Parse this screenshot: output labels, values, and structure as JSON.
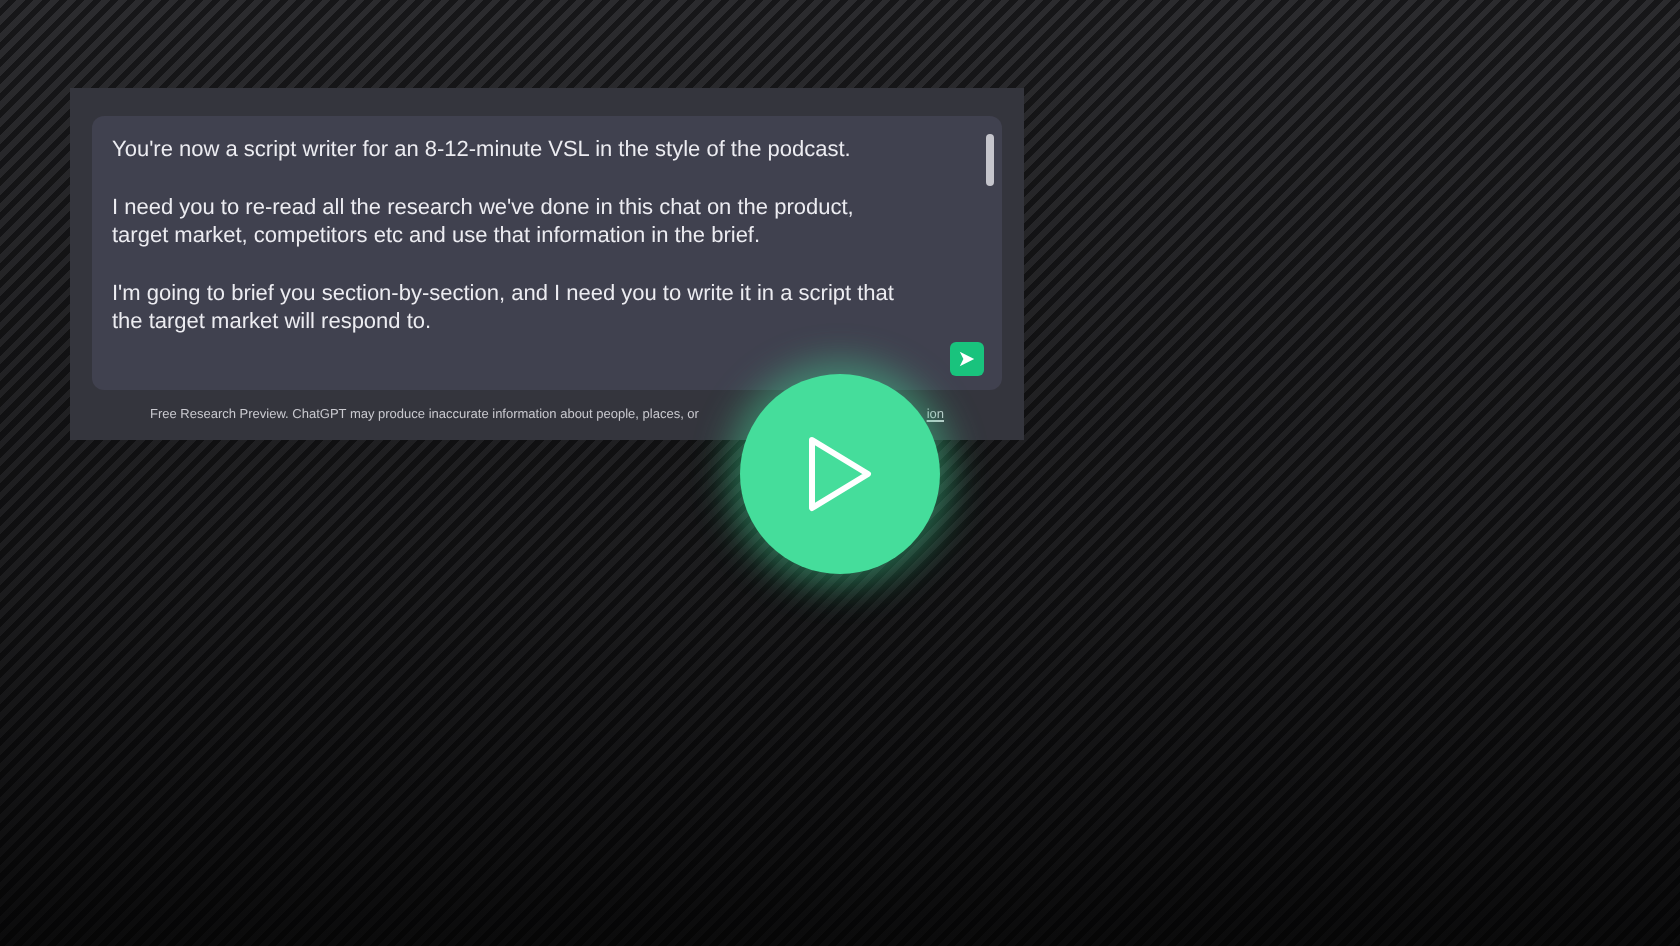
{
  "prompt": {
    "paragraphs": [
      "You're now a script writer for an 8-12-minute VSL in the style of the podcast.",
      "I need you to re-read all the research we've done in this chat on the product, target market, competitors etc and use that information in the brief.",
      "I'm going to brief you section-by-section, and I need you to write it in a script that the target market will respond to."
    ]
  },
  "footer": {
    "text": "Free Research Preview. ChatGPT may produce inaccurate information about people, places, or",
    "link": "ion"
  },
  "video": {
    "play_button": true
  }
}
